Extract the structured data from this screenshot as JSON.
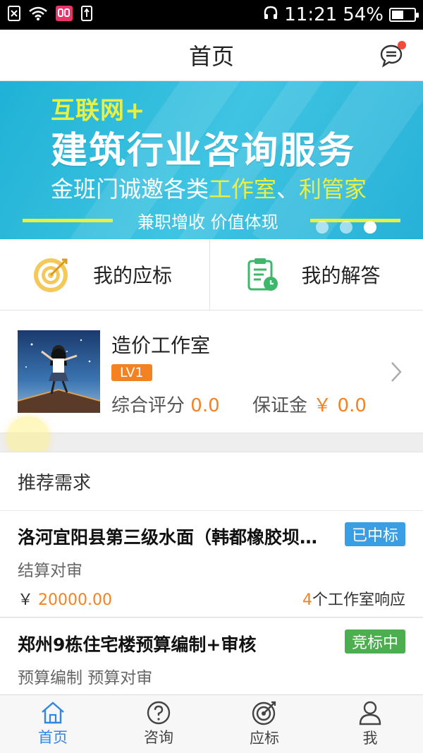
{
  "status_bar": {
    "time": "11:21",
    "battery_percent": "54%",
    "battery_level": 0.54,
    "icons": [
      "sim-off-icon",
      "wifi-icon",
      "app-notification-icon",
      "usb-icon",
      "headphone-icon",
      "battery-icon"
    ]
  },
  "header": {
    "title": "首页",
    "message_icon": "chat-bubble-icon",
    "has_unread": true
  },
  "banner": {
    "line1": "互联网+",
    "line2": "建筑行业咨询服务",
    "line3_prefix": "金班门诚邀各类",
    "line3_highlight1": "工作室",
    "line3_sep": "、",
    "line3_highlight2": "利管家",
    "line4": "兼职增收 价值体现",
    "slide_count": 3,
    "active_slide": 3
  },
  "quick_actions": [
    {
      "label": "我的应标",
      "icon": "target-icon"
    },
    {
      "label": "我的解答",
      "icon": "clipboard-clock-icon"
    }
  ],
  "studio": {
    "name": "造价工作室",
    "level": "LV1",
    "rating_label": "综合评分",
    "rating_value": "0.0",
    "deposit_label": "保证金",
    "deposit_value": "￥ 0.0"
  },
  "recommended": {
    "heading": "推荐需求",
    "items": [
      {
        "title": "洛河宜阳县第三级水面（韩都橡胶坝…",
        "tag": "已中标",
        "tag_color": "#3a9ee4",
        "subtitle": "结算对审",
        "price_prefix": "￥",
        "price": "20000.00",
        "responses_count": "4",
        "responses_suffix": "个工作室响应"
      },
      {
        "title": "郑州9栋住宅楼预算编制+审核",
        "tag": "竞标中",
        "tag_color": "#4cae4f",
        "subtitle": "预算编制 预算对审"
      }
    ]
  },
  "tabbar": {
    "items": [
      {
        "label": "首页",
        "icon": "home-icon",
        "active": true
      },
      {
        "label": "咨询",
        "icon": "question-icon",
        "active": false
      },
      {
        "label": "应标",
        "icon": "bid-target-icon",
        "active": false
      },
      {
        "label": "我",
        "icon": "user-icon",
        "active": false
      }
    ]
  },
  "colors": {
    "accent_blue": "#2e86e6",
    "orange": "#f58220",
    "banner_cyan": "#2eb9dc",
    "banner_yellow": "#e8f044"
  }
}
